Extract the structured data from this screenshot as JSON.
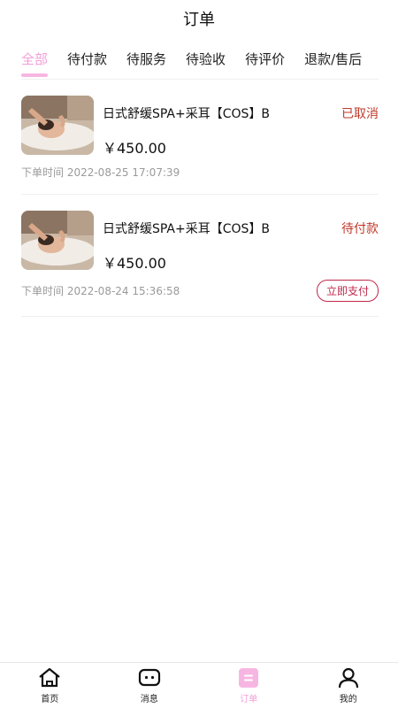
{
  "header": {
    "title": "订单"
  },
  "tabs": [
    {
      "label": "全部",
      "active": true
    },
    {
      "label": "待付款"
    },
    {
      "label": "待服务"
    },
    {
      "label": "待验收"
    },
    {
      "label": "待评价"
    },
    {
      "label": "退款/售后"
    }
  ],
  "orders": [
    {
      "title": "日式舒缓SPA+采耳【COS】B",
      "price": "￥450.00",
      "status": "已取消",
      "time": "下单时间 2022-08-25 17:07:39"
    },
    {
      "title": "日式舒缓SPA+采耳【COS】B",
      "price": "￥450.00",
      "status": "待付款",
      "time": "下单时间 2022-08-24 15:36:58",
      "action": "立即支付"
    }
  ],
  "tabbar": [
    {
      "label": "首页",
      "icon": "home-icon"
    },
    {
      "label": "消息",
      "icon": "message-icon"
    },
    {
      "label": "订单",
      "icon": "order-icon",
      "active": true
    },
    {
      "label": "我的",
      "icon": "profile-icon"
    }
  ],
  "colors": {
    "accent": "#f29fd8",
    "status": "#c0392b",
    "button": "#c0284a"
  }
}
